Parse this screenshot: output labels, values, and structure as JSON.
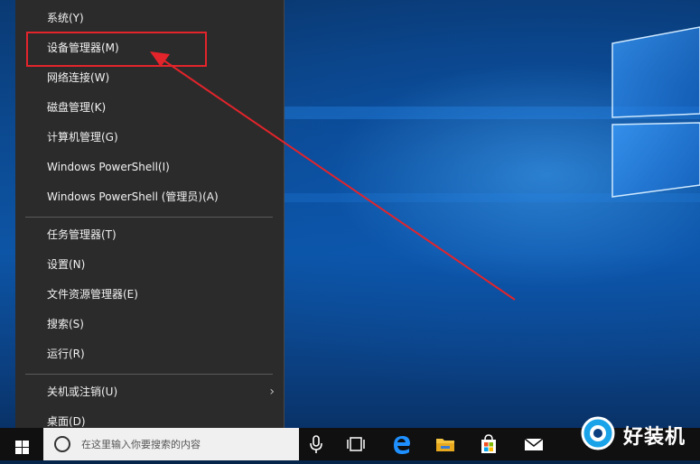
{
  "menu": {
    "items": [
      {
        "label": "系统(Y)"
      },
      {
        "label": "设备管理器(M)"
      },
      {
        "label": "网络连接(W)"
      },
      {
        "label": "磁盘管理(K)"
      },
      {
        "label": "计算机管理(G)"
      },
      {
        "label": "Windows PowerShell(I)"
      },
      {
        "label": "Windows PowerShell (管理员)(A)"
      },
      {
        "label": "任务管理器(T)"
      },
      {
        "label": "设置(N)"
      },
      {
        "label": "文件资源管理器(E)"
      },
      {
        "label": "搜索(S)"
      },
      {
        "label": "运行(R)"
      },
      {
        "label": "关机或注销(U)"
      },
      {
        "label": "桌面(D)"
      }
    ],
    "highlighted": "设备管理器(M)",
    "submenu_chevron": "›"
  },
  "taskbar": {
    "search_placeholder": "在这里输入你要搜索的内容",
    "icons": [
      "windows-start-icon",
      "microphone-icon",
      "task-view-icon",
      "edge-icon",
      "file-explorer-icon",
      "store-icon",
      "mail-icon"
    ]
  },
  "watermark": {
    "text": "好装机"
  },
  "colors": {
    "menu_bg": "#2b2b2b",
    "annotation_red": "#e3242b",
    "taskbar_bg": "#101010",
    "desktop_blue": "#0d55a6"
  }
}
